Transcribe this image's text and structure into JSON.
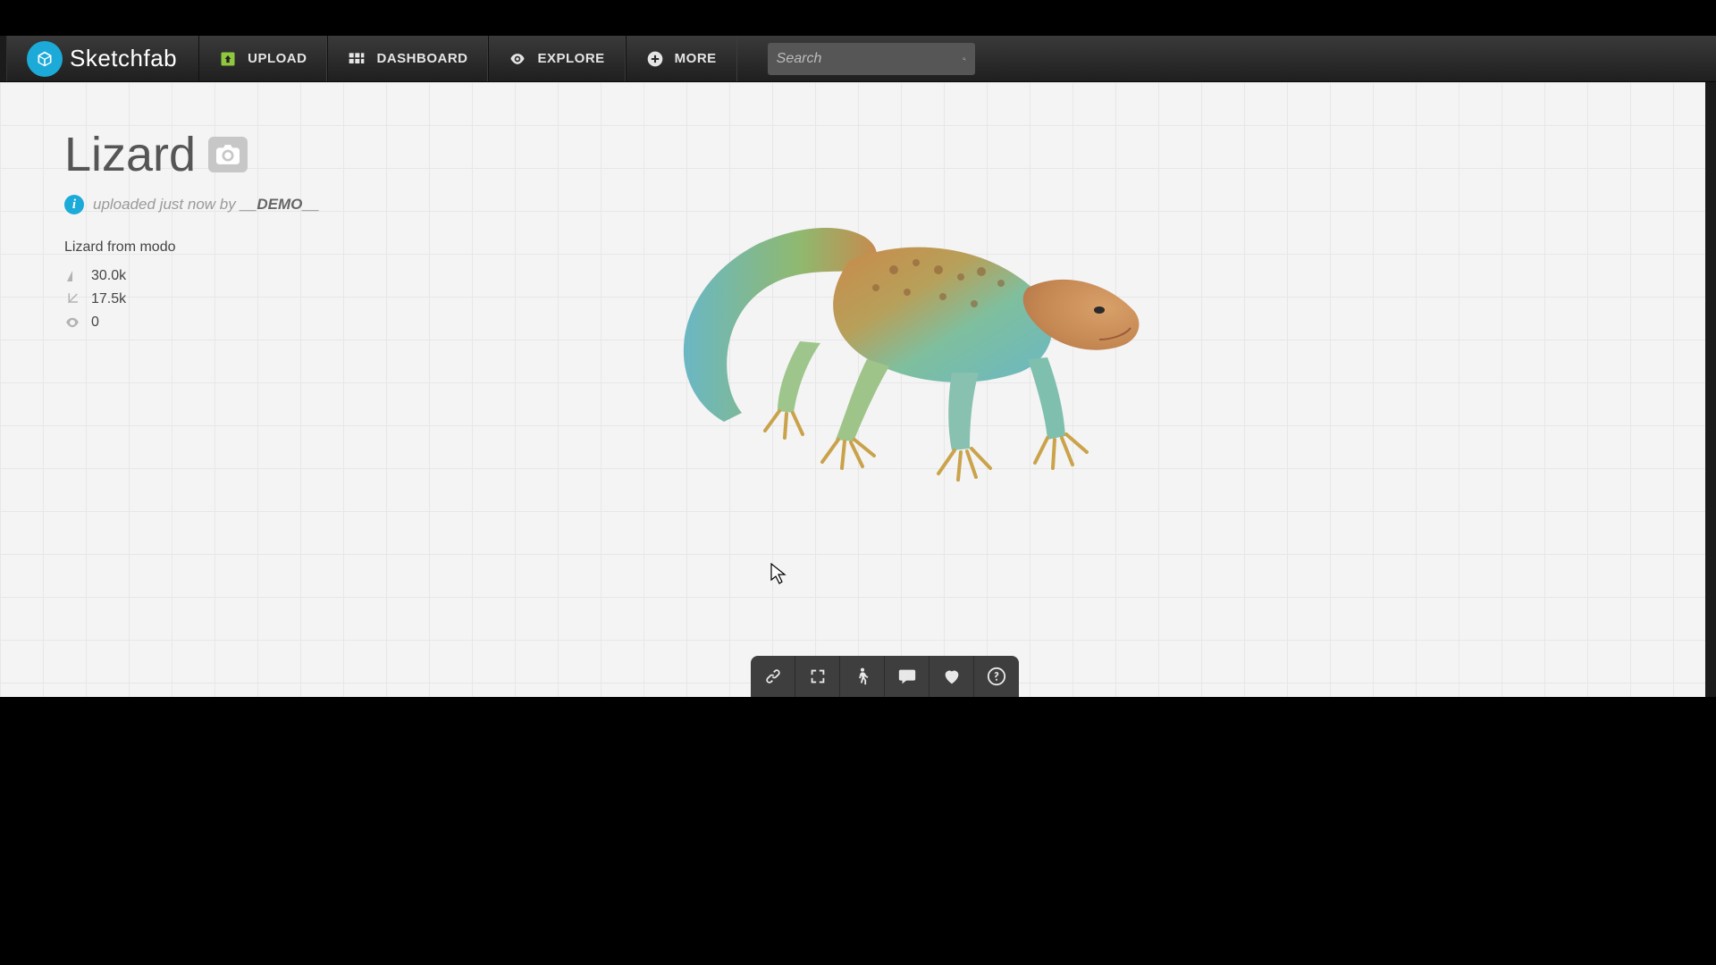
{
  "brand": {
    "name": "Sketchfab"
  },
  "nav": {
    "upload": "UPLOAD",
    "dashboard": "DASHBOARD",
    "explore": "EXPLORE",
    "more": "MORE"
  },
  "search": {
    "placeholder": "Search"
  },
  "model": {
    "title": "Lizard",
    "byline_prefix": "uploaded just now by ",
    "author": "__DEMO__",
    "description": "Lizard from modo",
    "stats": {
      "triangles": "30.0k",
      "vertices": "17.5k",
      "views": "0"
    }
  }
}
